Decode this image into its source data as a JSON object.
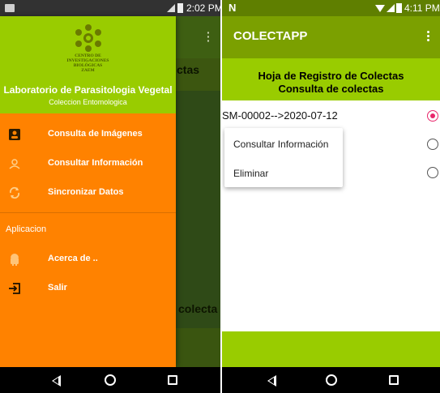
{
  "left_screen": {
    "status_bar": {
      "time": "2:02 PM"
    },
    "background_app": {
      "title_fragment": "ctas",
      "row_fragment": "colecta"
    },
    "drawer": {
      "header": {
        "logo_text_lines": [
          "CENTRO DE",
          "INVESTIGACIONES",
          "BIOLÓGICAS",
          "ZAEM"
        ],
        "title": "Laboratorio de Parasitologia Vegetal",
        "subtitle": "Coleccion Entomologica"
      },
      "items": [
        {
          "label": "Consulta de Imágenes",
          "icon": "person-card-icon"
        },
        {
          "label": "Consultar Información",
          "icon": "info-person-icon"
        },
        {
          "label": "Sincronizar Datos",
          "icon": "sync-icon"
        }
      ],
      "section_title": "Aplicacion",
      "app_items": [
        {
          "label": "Acerca de ..",
          "icon": "android-icon"
        },
        {
          "label": "Salir",
          "icon": "exit-icon"
        }
      ]
    }
  },
  "right_screen": {
    "status_bar": {
      "carrier_icon": "N",
      "time": "4:11 PM"
    },
    "app_bar": {
      "title": "COLECTAPP"
    },
    "banner": {
      "line1": "Hoja de Registro de Colectas",
      "line2": "Consulta de colectas"
    },
    "list": [
      {
        "text": "SM-00002-->2020-07-12",
        "selected": true
      },
      {
        "text": "",
        "selected": false
      },
      {
        "text": "",
        "selected": false
      }
    ],
    "context_menu": {
      "options": [
        "Consultar Información",
        "Eliminar"
      ]
    }
  },
  "colors": {
    "drawer_orange": "#ff8200",
    "header_green": "#99cc00",
    "appbar_green": "#7ba000",
    "radio_accent": "#e8266b"
  }
}
